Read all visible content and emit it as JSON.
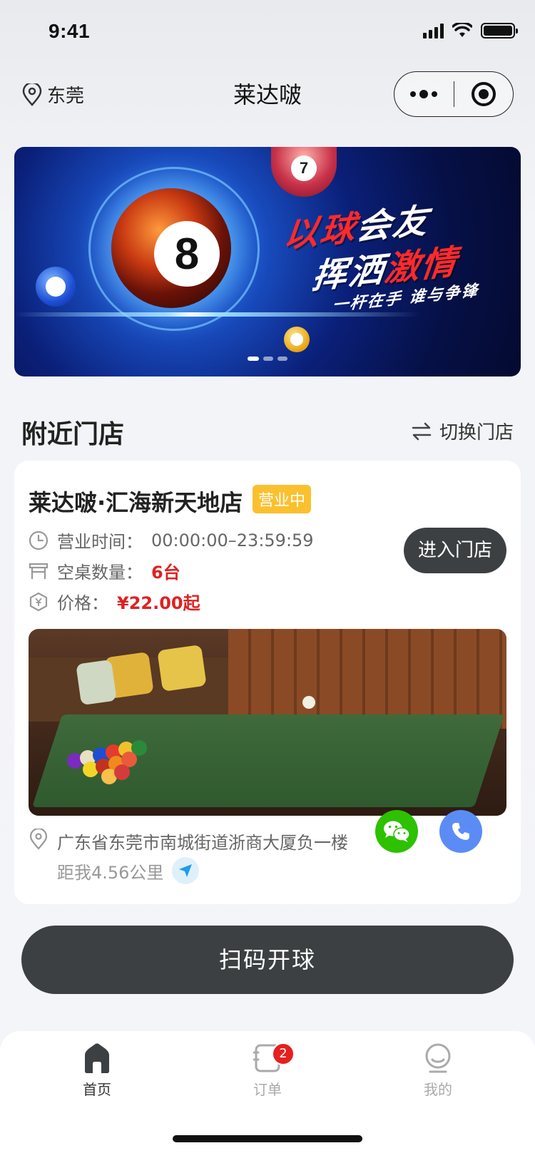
{
  "status": {
    "time": "9:41"
  },
  "nav": {
    "city": "东莞",
    "title": "莱达啵"
  },
  "banner": {
    "slogan_line1_white": "以球",
    "slogan_line1_accent": "会友",
    "slogan_line2_white": "挥洒",
    "slogan_line2_accent": "激情",
    "slogan_line3": "一杆在手  谁与争锋",
    "ball_main": "8",
    "ball_top": "7",
    "page_count": 3,
    "active_page": 1
  },
  "section": {
    "title": "附近门店",
    "switch_label": "切换门店"
  },
  "store": {
    "name": "莱达啵·汇海新天地店",
    "status_badge": "营业中",
    "hours_label": "营业时间：",
    "hours_value": "00:00:00–23:59:59",
    "tables_label": "空桌数量：",
    "tables_value": "6台",
    "price_label": "价格：",
    "price_value": "¥22.00起",
    "enter_button": "进入门店",
    "address": "广东省东莞市南城街道浙商大厦负一楼",
    "distance": "距我4.56公里"
  },
  "actions": {
    "scan_button": "扫码开球"
  },
  "tabbar": {
    "tabs": [
      {
        "label": "首页",
        "active": true
      },
      {
        "label": "订单",
        "active": false,
        "badge": "2"
      },
      {
        "label": "我的",
        "active": false
      }
    ]
  },
  "colors": {
    "accent_dark": "#3d4042",
    "badge_yellow": "#fbc02d",
    "price_red": "#e02020",
    "wechat_green": "#2dc100",
    "phone_blue": "#5b8cf5"
  }
}
